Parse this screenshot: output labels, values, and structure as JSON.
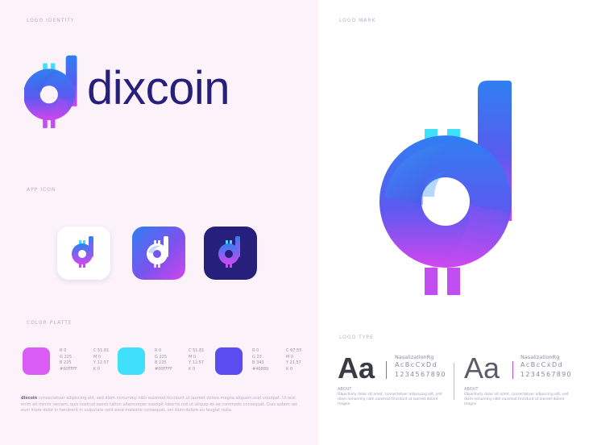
{
  "sections": {
    "logo_identity": "LOGO IDENTITY",
    "logo_mark": "LOGO MARK",
    "app_icon": "APP ICON",
    "color_palette": "COLOR PLATTE",
    "logo_type": "LOGO TYPE"
  },
  "brand": {
    "name": "dixcoin"
  },
  "icons": {
    "logo": "dixcoin-d-bitcoin-logo-icon",
    "app_white": "app-icon-white",
    "app_gradient": "app-icon-gradient",
    "app_dark": "app-icon-dark"
  },
  "colors": {
    "navy": "#271f7c",
    "blue": "#2f7ff1",
    "violet": "#6b4fe9",
    "magenta": "#d246ee",
    "cyan": "#3fe0fa"
  },
  "palette": [
    {
      "color": "#d95cf4",
      "rows": [
        [
          "R 0",
          "C 51.81"
        ],
        [
          "G 225",
          "M 0"
        ],
        [
          "B 225",
          "Y 12.57"
        ],
        [
          "#00FFFF",
          "K 0"
        ]
      ]
    },
    {
      "color": "#3fe0fa",
      "rows": [
        [
          "R 0",
          "C 51.81"
        ],
        [
          "G 225",
          "M 0"
        ],
        [
          "B 225",
          "Y 12.57"
        ],
        [
          "#00FFFF",
          "K 0"
        ]
      ]
    },
    {
      "color": "#5b4cf0",
      "rows": [
        [
          "R 0",
          "C 67.55"
        ],
        [
          "G 23",
          "M 0"
        ],
        [
          "B 343",
          "Y 21.57"
        ],
        [
          "#46889",
          "K 0"
        ]
      ]
    }
  ],
  "blurb": {
    "lead": "dixcoin",
    "text": "consectetuer adipiscing elit, sed diam nonummy nibh euismod tincidunt ut laoreet dolore magna aliquam erat volutpat. Ut wisi enim ad minim veniam, quis nostrud exerci tation ullamcorper suscipit lobortis nisl ut aliquip ex ea commodo consequat. Duis autem vel eum iriure dolor in hendrerit in vulputate velit esse molestie consequat, vel illum dolore eu feugiat nulla"
  },
  "logo_type": [
    {
      "sample": "Aa",
      "font": "NasalizationRg",
      "letters": "AcBcCxDd",
      "numbers": "1234567890",
      "about_heading": "ABOUT",
      "about_text": "Objectivity dolor sit amet, consectetuer adipiscing elit, sed diam nonummy nibh euismod tincidunt ut laoreet dolore magna"
    },
    {
      "sample": "Aa",
      "font": "NasalizationRg",
      "letters": "AcBcCxDd",
      "numbers": "1234567890",
      "about_heading": "ABOUT",
      "about_text": "Objectivity dolor sit amet, consectetuer adipiscing elit, sed diam nonummy nibh euismod tincidunt ut laoreet dolore magna"
    }
  ]
}
